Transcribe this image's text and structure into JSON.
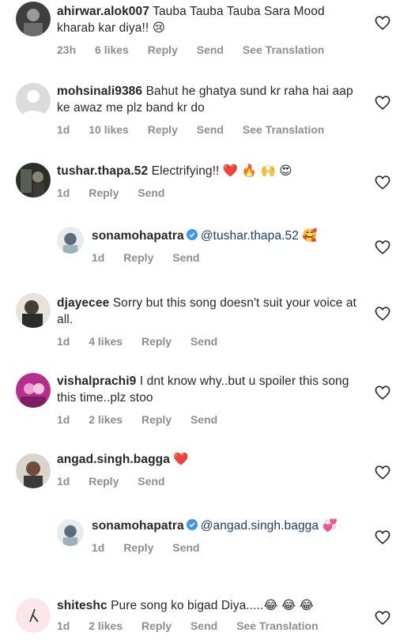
{
  "comments": [
    {
      "username": "ahirwar.alok007",
      "text": "Tauba Tauba Tauba Sara Mood kharab kar diya!!",
      "emoji": "😢",
      "time": "23h",
      "likes": "6 likes",
      "reply": "Reply",
      "send": "Send",
      "translate": "See Translation",
      "avatar_icon": "avatar-photo-icon"
    },
    {
      "username": "mohsinali9386",
      "text": "Bahut he ghatya sund kr raha hai aap ke awaz me plz band kr do",
      "time": "1d",
      "likes": "10 likes",
      "reply": "Reply",
      "send": "Send",
      "translate": "See Translation",
      "avatar_icon": "default-avatar-icon"
    },
    {
      "username": "tushar.thapa.52",
      "text": "Electrifying!!",
      "emoji": "❤️ 🔥 🙌 😍",
      "time": "1d",
      "reply": "Reply",
      "send": "Send",
      "avatar_icon": "avatar-photo-icon"
    },
    {
      "username": "sonamohapatra",
      "mention": "@tushar.thapa.52",
      "emoji": "🥰",
      "time": "1d",
      "reply": "Reply",
      "send": "Send",
      "verified_icon": "verified-badge-icon"
    },
    {
      "username": "djayecee",
      "text": "Sorry but this song doesn't suit your voice at all.",
      "time": "1d",
      "likes": "4 likes",
      "reply": "Reply",
      "send": "Send",
      "avatar_icon": "avatar-photo-icon"
    },
    {
      "username": "vishalprachi9",
      "text": "I dnt know why..but u spoiler this song this time..plz stoo",
      "time": "1d",
      "likes": "2 likes",
      "reply": "Reply",
      "send": "Send",
      "avatar_icon": "avatar-photo-icon"
    },
    {
      "username": "angad.singh.bagga",
      "emoji": "❤️",
      "time": "1d",
      "reply": "Reply",
      "send": "Send",
      "avatar_icon": "avatar-photo-icon"
    },
    {
      "username": "sonamohapatra",
      "mention": "@angad.singh.bagga",
      "emoji": "💞",
      "time": "1d",
      "reply": "Reply",
      "send": "Send",
      "verified_icon": "verified-badge-icon"
    },
    {
      "username": "shiteshc",
      "text": "Pure song ko bigad Diya.....",
      "emoji": "😂 😂 😂",
      "time": "1d",
      "likes": "2 likes",
      "reply": "Reply",
      "send": "Send",
      "translate": "See Translation",
      "avatar_icon": "avatar-photo-icon"
    }
  ],
  "colors": {
    "text": "#262626",
    "meta": "#8e8e8e",
    "verified": "#3897f0",
    "mention": "#1a3a6b"
  }
}
